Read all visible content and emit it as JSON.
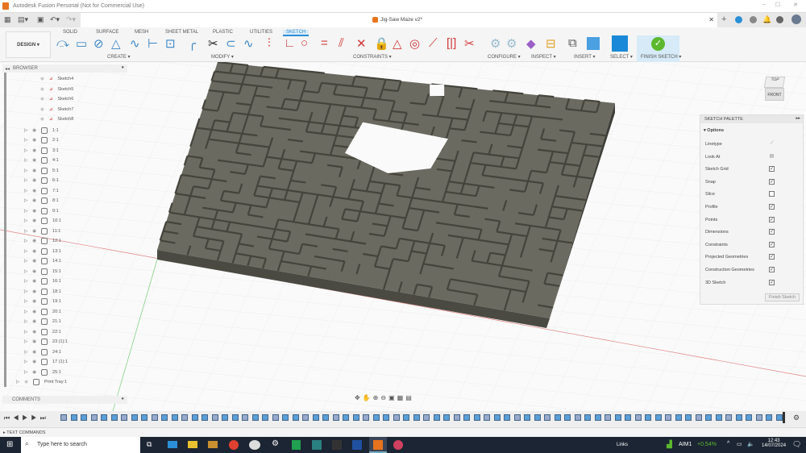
{
  "window": {
    "title": "Autodesk Fusion Personal (Not for Commercial Use)",
    "doc_tab": "Jig-Saw Maze v2*"
  },
  "ribbon": {
    "workspace": "DESIGN ▾",
    "tabs": [
      "SOLID",
      "SURFACE",
      "MESH",
      "SHEET METAL",
      "PLASTIC",
      "UTILITIES",
      "SKETCH"
    ],
    "active_tab": "SKETCH",
    "groups": [
      "CREATE ▾",
      "MODIFY ▾",
      "CONSTRAINTS ▾",
      "CONFIGURE ▾",
      "INSPECT ▾",
      "INSERT ▾",
      "SELECT ▾",
      "FINISH SKETCH ▾"
    ]
  },
  "browser": {
    "title": "BROWSER",
    "sketches": [
      "Sketch4",
      "Sketch5",
      "Sketch6",
      "Sketch7",
      "Sketch8"
    ],
    "bodies": [
      "1:1",
      "2:1",
      "3:1",
      "4:1",
      "5:1",
      "6:1",
      "7:1",
      "8:1",
      "9:1",
      "10:1",
      "11:1",
      "12:1",
      "13:1",
      "14:1",
      "15:1",
      "16:1",
      "18:1",
      "19:1",
      "20:1",
      "21:1",
      "22:1",
      "23 (1):1",
      "24:1",
      "17 (1):1",
      "25:1"
    ],
    "tray": "Print Tray:1"
  },
  "comments": {
    "title": "COMMENTS"
  },
  "palette": {
    "title": "SKETCH PALETTE",
    "section": "Options",
    "rows": [
      {
        "label": "Linetype",
        "type": "icon"
      },
      {
        "label": "Look At",
        "type": "icon"
      },
      {
        "label": "Sketch Grid",
        "checked": true
      },
      {
        "label": "Snap",
        "checked": true
      },
      {
        "label": "Slice",
        "checked": false
      },
      {
        "label": "Profile",
        "checked": true
      },
      {
        "label": "Points",
        "checked": true
      },
      {
        "label": "Dimensions",
        "checked": true
      },
      {
        "label": "Constraints",
        "checked": true
      },
      {
        "label": "Projected Geometries",
        "checked": true
      },
      {
        "label": "Construction Geometries",
        "checked": true
      },
      {
        "label": "3D Sketch",
        "checked": true
      }
    ],
    "finish": "Finish Sketch"
  },
  "viewcube": {
    "top": "TOP",
    "front": "FRONT"
  },
  "textcommands": "TEXT COMMANDS",
  "taskbar": {
    "search": "Type here to search",
    "links": "Links",
    "ticker": "AIM1",
    "change": "+0.54%",
    "time": "12:43",
    "date": "14/07/2024"
  },
  "colors": {
    "accent": "#2a8fd6",
    "maze": "#5a5a50",
    "finish": "#5cb82e",
    "taskbar": "#1c2533"
  }
}
